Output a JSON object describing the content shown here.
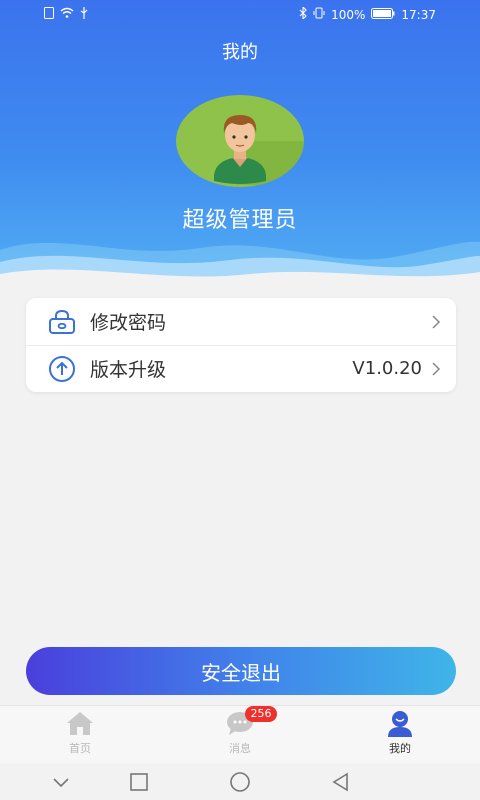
{
  "status_bar": {
    "battery": "100%",
    "time": "17:37"
  },
  "header": {
    "title": "我的",
    "user_name": "超级管理员"
  },
  "menu": [
    {
      "label": "修改密码",
      "icon": "lock-icon",
      "value": ""
    },
    {
      "label": "版本升级",
      "icon": "upload-icon",
      "value": "V1.0.20"
    }
  ],
  "logout_label": "安全退出",
  "tabs": [
    {
      "label": "首页",
      "icon": "home-icon",
      "active": false
    },
    {
      "label": "消息",
      "icon": "chat-icon",
      "active": false,
      "badge": "256"
    },
    {
      "label": "我的",
      "icon": "profile-icon",
      "active": true
    }
  ],
  "colors": {
    "header_top": "#3b73ee",
    "header_bottom": "#53b0f3",
    "accent": "#3a72d6",
    "badge": "#f0302a"
  }
}
